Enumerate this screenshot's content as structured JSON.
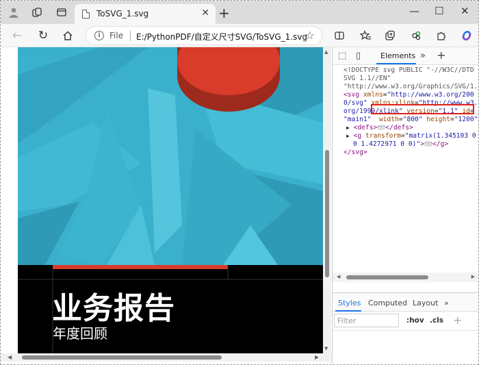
{
  "browser": {
    "tab_title": "ToSVG_1.svg",
    "address_prefix": "File",
    "url": "E:/PythonPDF/自定义尺寸SVG/ToSVG_1.svg"
  },
  "page": {
    "title": "业务报告",
    "subtitle": "年度回顾",
    "colors": {
      "sky": "#3ab0cc",
      "accent": "#d93c2a",
      "banner": "#000000"
    }
  },
  "devtools": {
    "active_tab": "Elements",
    "dom_lines": {
      "l1": "<!DOCTYPE svg PUBLIC \"-//W3C//DTD",
      "l2": "SVG 1.1//EN\"",
      "l3": "\"http://www.w3.org/Graphics/SVG/1.1",
      "svg_tag": "svg",
      "xmlns_attr": "xmlns",
      "xmlns_val1": "\"http://www.w3.org/200",
      "xmlns_val2": "0/svg\"",
      "xlink_attr": "xmlns:xlink",
      "xlink_val1": "\"http://www.w3.",
      "xlink_val2": "org/1999/xlink\"",
      "version_attr": "version",
      "version_val": "\"1.1\"",
      "id_attr": "id",
      "id_val": "\"main1\"",
      "width_attr": "width",
      "width_val": "\"800\"",
      "height_attr": "height",
      "height_val": "\"1200\"",
      "defs_tag": "defs",
      "g_tag": "g",
      "transform_attr": "transform",
      "transform_val1": "\"matrix(1.345103 0",
      "transform_val2": "0 1.4272971 0 0)\"",
      "close_svg": "</svg>"
    },
    "styles_tabs": [
      "Styles",
      "Computed",
      "Layout"
    ],
    "filter_placeholder": "Filter",
    "hov": ":hov",
    "cls": ".cls"
  },
  "icons": [
    "profile-icon",
    "collections-icon",
    "tab-actions-icon",
    "back-icon",
    "refresh-icon",
    "home-icon",
    "info-icon",
    "star-icon",
    "split-screen-icon",
    "favorites-icon",
    "collections-icon",
    "extension-icon",
    "copilot-icon"
  ]
}
